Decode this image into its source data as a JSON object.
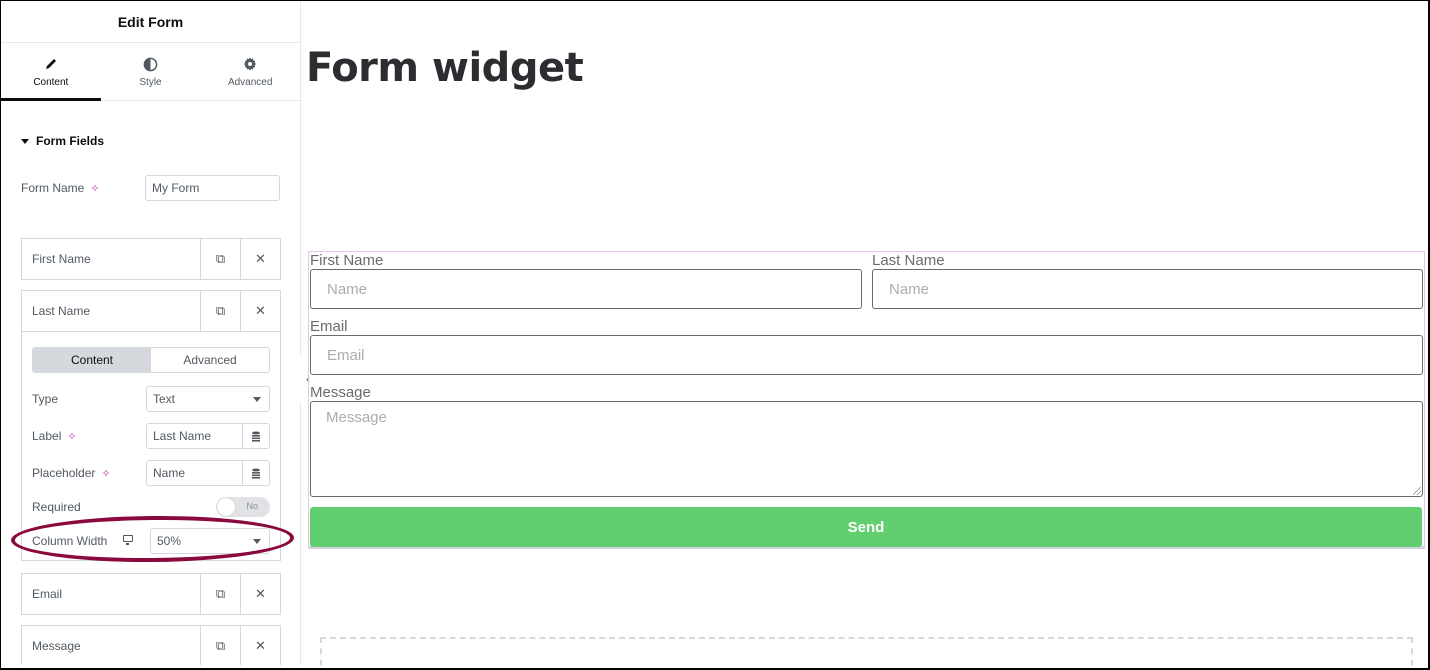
{
  "sidebar": {
    "title": "Edit Form",
    "tabs": [
      {
        "label": "Content",
        "icon": "pencil-icon",
        "active": true
      },
      {
        "label": "Style",
        "icon": "half-circle-icon",
        "active": false
      },
      {
        "label": "Advanced",
        "icon": "gear-icon",
        "active": false
      }
    ],
    "section_title": "Form Fields",
    "form_name": {
      "label": "Form Name",
      "value": "My Form"
    },
    "fields": [
      {
        "title": "First Name"
      },
      {
        "title": "Last Name"
      },
      {
        "title": "Email"
      },
      {
        "title": "Message"
      }
    ],
    "expanded_field": {
      "subtabs": [
        "Content",
        "Advanced"
      ],
      "active_subtab": "Content",
      "type": {
        "label": "Type",
        "value": "Text"
      },
      "label": {
        "label": "Label",
        "value": "Last Name"
      },
      "placeholder": {
        "label": "Placeholder",
        "value": "Name"
      },
      "required": {
        "label": "Required",
        "value": "No"
      },
      "column_width": {
        "label": "Column Width",
        "value": "50%"
      }
    }
  },
  "canvas": {
    "page_title": "Form widget",
    "form": {
      "fields": [
        {
          "label": "First Name",
          "placeholder": "Name"
        },
        {
          "label": "Last Name",
          "placeholder": "Name"
        },
        {
          "label": "Email",
          "placeholder": "Email"
        },
        {
          "label": "Message",
          "placeholder": "Message"
        }
      ],
      "submit_label": "Send"
    }
  },
  "colors": {
    "accent_ai": "#c13fb1",
    "submit_button": "#61ce70",
    "highlight_ellipse": "#8a0a3e",
    "widget_outline": "#e4c8ea"
  },
  "icons": {
    "copy": "⧉",
    "remove": "✕",
    "ai": "✧",
    "dynamic": "≡",
    "collapse": "‹"
  }
}
